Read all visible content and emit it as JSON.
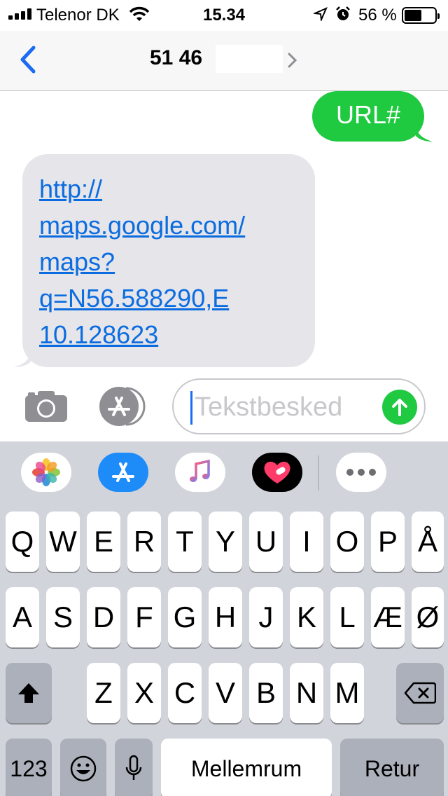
{
  "status": {
    "carrier": "Telenor DK",
    "time": "15.34",
    "battery_pct": "56 %",
    "battery_level": 0.56
  },
  "nav": {
    "contact": "51 46"
  },
  "messages": {
    "outgoing": "URL#",
    "incoming_lines": [
      "http://",
      "maps.google.com/",
      "maps?",
      "q=N56.588290,E",
      "10.128623"
    ]
  },
  "composer": {
    "placeholder": "Tekstbesked"
  },
  "keyboard": {
    "row1": [
      "Q",
      "W",
      "E",
      "R",
      "T",
      "Y",
      "U",
      "I",
      "O",
      "P",
      "Å"
    ],
    "row2": [
      "A",
      "S",
      "D",
      "F",
      "G",
      "H",
      "J",
      "K",
      "L",
      "Æ",
      "Ø"
    ],
    "row3": [
      "Z",
      "X",
      "C",
      "V",
      "B",
      "N",
      "M"
    ],
    "numbers_label": "123",
    "space_label": "Mellemrum",
    "return_label": "Retur"
  },
  "colors": {
    "imessage_green": "#1fc940",
    "link_blue": "#0b6ce0",
    "ios_blue": "#1b6cf2"
  }
}
